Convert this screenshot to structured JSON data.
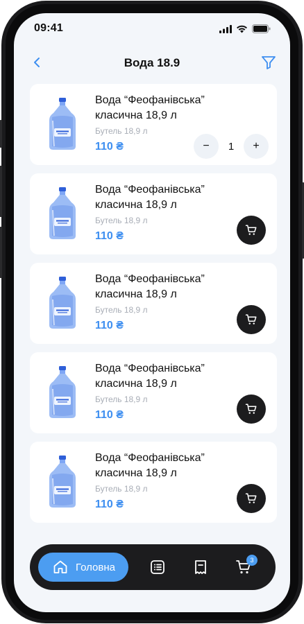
{
  "status_bar": {
    "time": "09:41"
  },
  "header": {
    "title": "Вода 18.9"
  },
  "products": [
    {
      "name": "Вода “Феофанівська” класична 18,9 л",
      "subtitle": "Бутель 18,9 л",
      "price": "110 ₴",
      "quantity": "1",
      "in_cart": true
    },
    {
      "name": "Вода “Феофанівська” класична 18,9 л",
      "subtitle": "Бутель 18,9 л",
      "price": "110 ₴",
      "in_cart": false
    },
    {
      "name": "Вода “Феофанівська” класична 18,9 л",
      "subtitle": "Бутель 18,9 л",
      "price": "110 ₴",
      "in_cart": false
    },
    {
      "name": "Вода “Феофанівська” класична 18,9 л",
      "subtitle": "Бутель 18,9 л",
      "price": "110 ₴",
      "in_cart": false
    },
    {
      "name": "Вода “Феофанівська” класична 18,9 л",
      "subtitle": "Бутель 18,9 л",
      "price": "110 ₴",
      "in_cart": false
    }
  ],
  "stepper": {
    "minus": "−",
    "plus": "+"
  },
  "bottom_nav": {
    "home_label": "Головна",
    "cart_count": "3",
    "items": [
      "home-icon",
      "list-icon",
      "receipt-icon",
      "cart-icon"
    ]
  },
  "colors": {
    "accent": "#4c9df1",
    "price": "#3d8ef0",
    "dark": "#1c1c1e",
    "background": "#f3f6fa"
  }
}
